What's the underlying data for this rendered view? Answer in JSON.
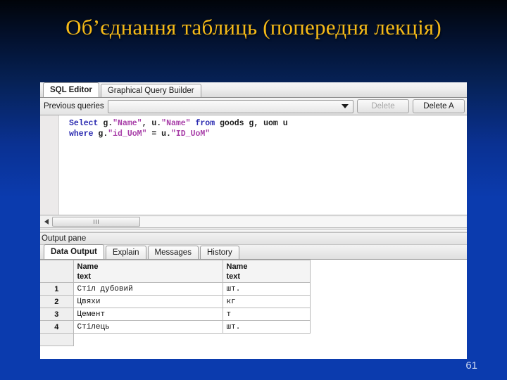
{
  "slide": {
    "title": "Об’єднання таблиць (попередня лекція)",
    "page_number": "61",
    "title_color": "#f5ba18",
    "background_top_color": "#010409",
    "background_bottom_color": "#0b3bae"
  },
  "app": {
    "editor_tabs": [
      {
        "label": "SQL Editor",
        "active": true
      },
      {
        "label": "Graphical Query Builder",
        "active": false
      }
    ],
    "toolbar": {
      "previous_queries_label": "Previous queries",
      "combo_value": "",
      "combo_placeholder": "",
      "delete_label": "Delete",
      "delete_disabled": true,
      "delete_all_label": "Delete A"
    },
    "sql": {
      "line1": {
        "kw_select": "Select",
        "t1": " g.",
        "s1": "\"Name\"",
        "t2": ", u.",
        "s2": "\"Name\"",
        "t3": " ",
        "kw_from": "from",
        "t4": " goods g, uom u"
      },
      "line2": {
        "kw_where": "where",
        "t1": " g.",
        "s1": "\"id_UoM\"",
        "t2": " = u.",
        "s2": "\"ID_UoM\""
      },
      "plain_text": "Select g.\"Name\", u.\"Name\" from goods g, uom u\nwhere g.\"id_UoM\" = u.\"ID_UoM\""
    },
    "output_pane": {
      "title": "Output pane",
      "tabs": [
        {
          "label": "Data Output",
          "active": true
        },
        {
          "label": "Explain",
          "active": false
        },
        {
          "label": "Messages",
          "active": false
        },
        {
          "label": "History",
          "active": false
        }
      ],
      "grid": {
        "rownum_header": "",
        "columns": [
          {
            "name": "Name",
            "type": "text"
          },
          {
            "name": "Name",
            "type": "text"
          }
        ],
        "rows": [
          {
            "num": "1",
            "cells": [
              "Стіл дубовий",
              "шт."
            ]
          },
          {
            "num": "2",
            "cells": [
              "Цвяхи",
              "кг"
            ]
          },
          {
            "num": "3",
            "cells": [
              "Цемент",
              "т"
            ]
          },
          {
            "num": "4",
            "cells": [
              "Стілець",
              "шт."
            ]
          }
        ]
      }
    }
  }
}
